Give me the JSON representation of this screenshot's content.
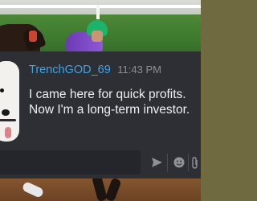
{
  "message": {
    "author": "TrenchGOD_69",
    "time": "11:43 PM",
    "text": "I came here for quick profits. Now I'm a long-term investor."
  },
  "composer": {
    "placeholder": "",
    "icons": [
      "send-icon",
      "emoji-icon",
      "attach-icon"
    ]
  },
  "colors": {
    "username": "#3fa3e6",
    "timestamp": "#8c8f95",
    "card_bg": "#2d2f34",
    "message_text": "#eef0f3"
  }
}
